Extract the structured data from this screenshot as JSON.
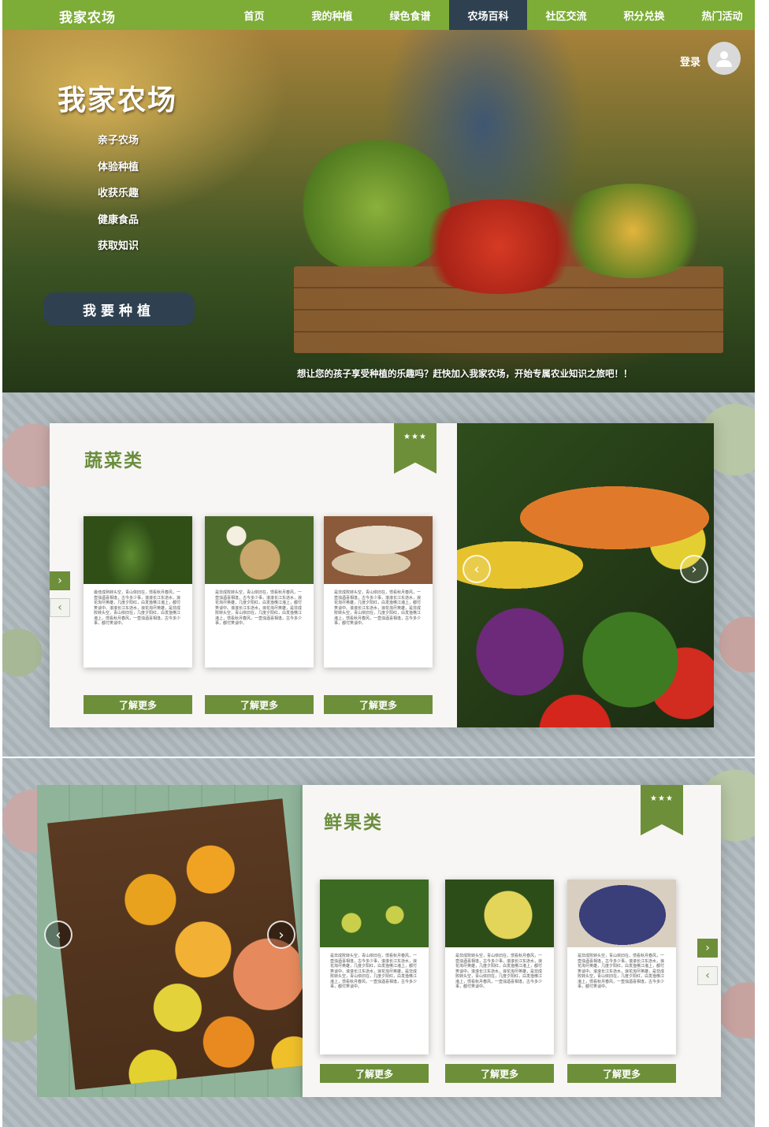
{
  "nav": {
    "logo": "我家农场",
    "items": [
      {
        "label": "首页"
      },
      {
        "label": "我的种植"
      },
      {
        "label": "绿色食谱"
      },
      {
        "label": "农场百科"
      },
      {
        "label": "社区交流"
      },
      {
        "label": "积分兑换"
      },
      {
        "label": "热门活动"
      }
    ],
    "active_item": "农场百科"
  },
  "hero": {
    "title": "我家农场",
    "links": [
      "亲子农场",
      "体验种植",
      "收获乐趣",
      "健康食品",
      "获取知识"
    ],
    "cta": "我要种植",
    "login": "登录",
    "avatar_icon": "user-icon",
    "tagline": "想让您的孩子享受种植的乐趣吗？赶快加入我家农场，开始专属农业知识之旅吧！！"
  },
  "vegetables": {
    "title": "蔬菜类",
    "stars": "★★★",
    "cards": [
      {
        "image": "okra",
        "text": "最佳成熟转头空，青山依旧在，惯看秋月春风，一壶浊酒喜相逢，古今多少事，滚滚长江东逝水，浪花淘尽英雄，几度夕阳红，白发渔樵江渚上，都付笑谈中。滚滚长江东逝水，浪花淘尽英雄，是非成败转头空，青山依旧在，几度夕阳红，白发渔樵江渚上，惯看秋月春风，一壶浊酒喜相逢，古今多少事，都付笑谈中。",
        "button": "了解更多"
      },
      {
        "image": "potato",
        "text": "是非成败转头空，青山依旧在，惯看秋月春风，一壶浊酒喜相逢，古今多少事，滚滚长江东逝水，浪花淘尽英雄，几度夕阳红，白发渔樵江渚上，都付笑谈中。滚滚长江东逝水，浪花淘尽英雄，是非成败转头空，青山依旧在，几度夕阳红，白发渔樵江渚上，惯看秋月春风，一壶浊酒喜相逢，古今多少事，都付笑谈中。",
        "button": "了解更多"
      },
      {
        "image": "yam",
        "text": "是非成败转头空，青山依旧在，惯看秋月春风，一壶浊酒喜相逢，古今多少事，滚滚长江东逝水，浪花淘尽英雄，几度夕阳红，白发渔樵江渚上，都付笑谈中。滚滚长江东逝水，浪花淘尽英雄，是非成败转头空，青山依旧在，几度夕阳红，白发渔樵江渚上，惯看秋月春风，一壶浊酒喜相逢，古今多少事，都付笑谈中。",
        "button": "了解更多"
      }
    ],
    "next_icon": "chevron-right-icon",
    "prev_icon": "chevron-left-icon"
  },
  "fruits": {
    "title": "鲜果类",
    "stars": "★★★",
    "cards": [
      {
        "image": "pear",
        "text": "是非成败转头空，青山依旧在，惯看秋月春风，一壶浊酒喜相逢，古今多少事，滚滚长江东逝水，浪花淘尽英雄，几度夕阳红，白发渔樵江渚上，都付笑谈中。滚滚长江东逝水，浪花淘尽英雄，是非成败转头空，青山依旧在，几度夕阳红，白发渔樵江渚上，惯看秋月春风，一壶浊酒喜相逢，古今多少事，都付笑谈中。",
        "button": "了解更多"
      },
      {
        "image": "grapefruit",
        "text": "是非成败转头空，青山依旧在，惯看秋月春风，一壶浊酒喜相逢，古今多少事，滚滚长江东逝水，浪花淘尽英雄，几度夕阳红，白发渔樵江渚上，都付笑谈中。滚滚长江东逝水，浪花淘尽英雄，是非成败转头空，青山依旧在，几度夕阳红，白发渔樵江渚上，惯看秋月春风，一壶浊酒喜相逢，古今多少事，都付笑谈中。",
        "button": "了解更多"
      },
      {
        "image": "grape",
        "text": "是非成败转头空，青山依旧在，惯看秋月春风，一壶浊酒喜相逢，古今多少事，滚滚长江东逝水，浪花淘尽英雄，几度夕阳红，白发渔樵江渚上，都付笑谈中。滚滚长江东逝水，浪花淘尽英雄，是非成败转头空，青山依旧在，几度夕阳红，白发渔樵江渚上，惯看秋月春风，一壶浊酒喜相逢，古今多少事，都付笑谈中。",
        "button": "了解更多"
      }
    ],
    "next_icon": "chevron-right-icon",
    "prev_icon": "chevron-left-icon"
  },
  "colors": {
    "nav_green": "#7dac37",
    "nav_active": "#2f4150",
    "accent_green": "#6e8f3a",
    "title_green": "#6b8e3d"
  }
}
